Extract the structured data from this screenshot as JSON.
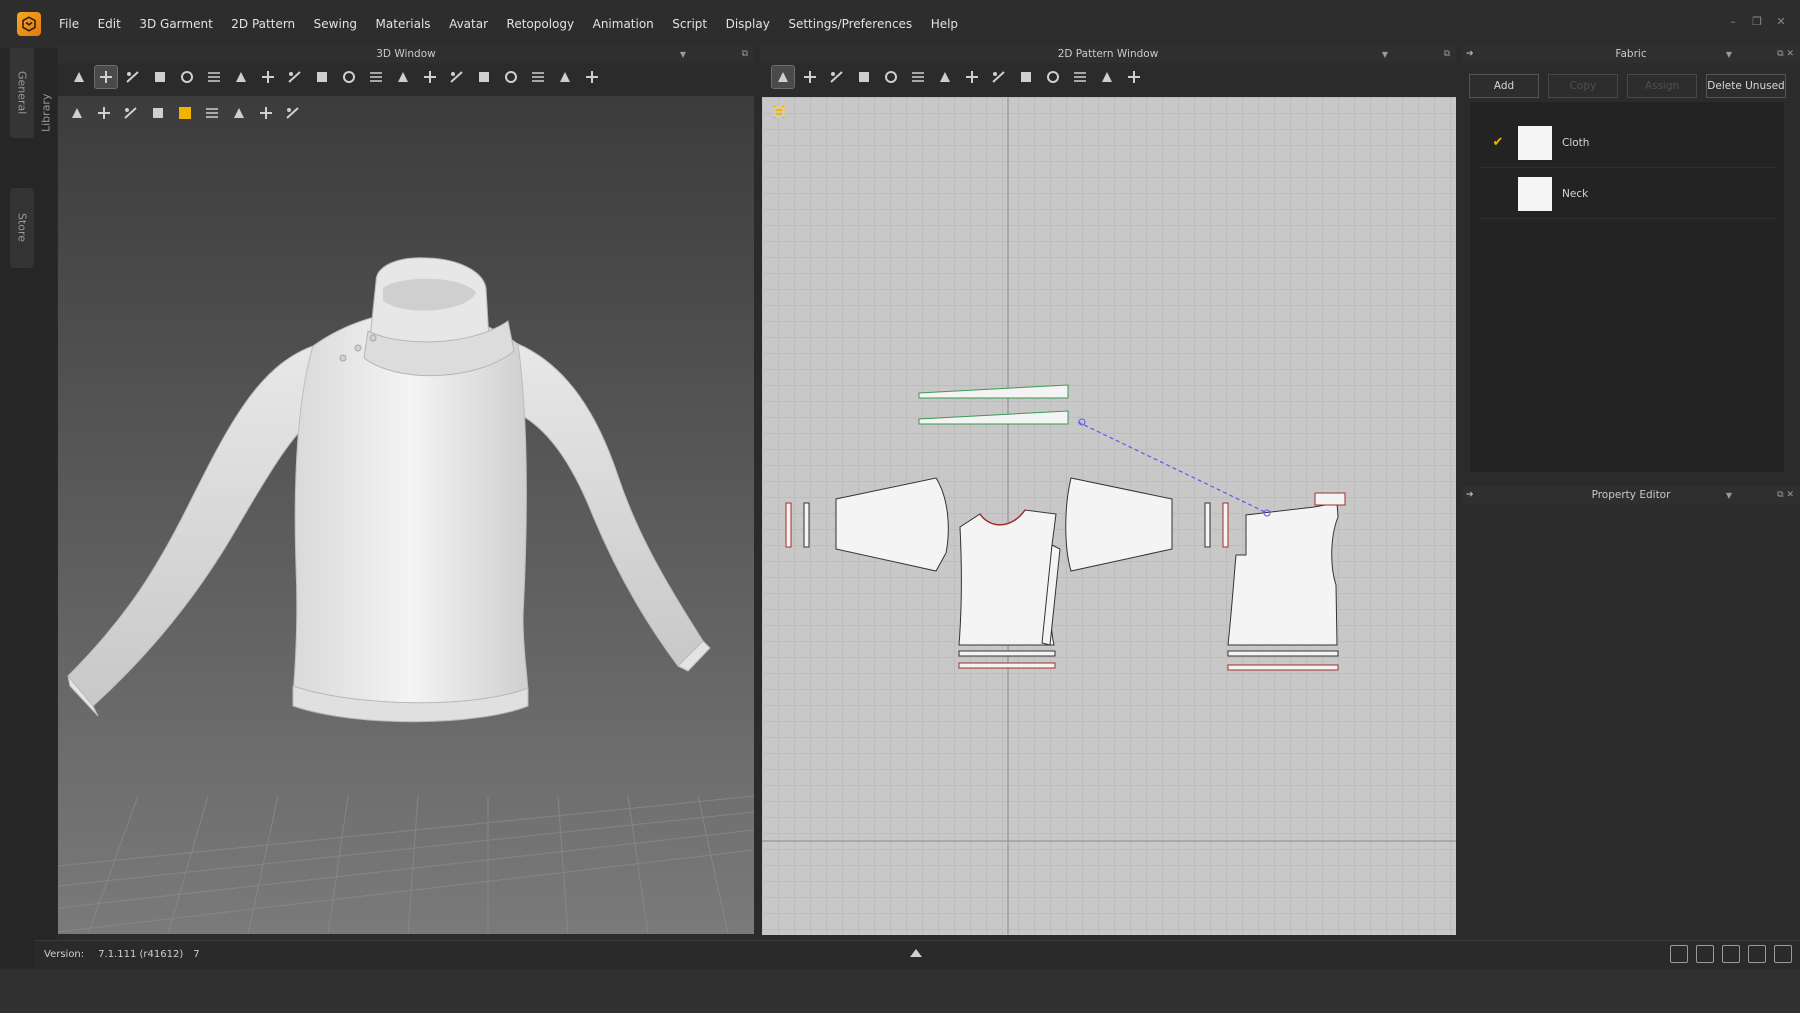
{
  "app": {
    "logo": "marvelous-designer-logo"
  },
  "menu": [
    "File",
    "Edit",
    "3D Garment",
    "2D Pattern",
    "Sewing",
    "Materials",
    "Avatar",
    "Retopology",
    "Animation",
    "Script",
    "Display",
    "Settings/Preferences",
    "Help"
  ],
  "window_controls": {
    "minimize": "–",
    "restore": "❐",
    "close": "✕"
  },
  "side_tabs": {
    "general": "General",
    "library": "Library",
    "store": "Store"
  },
  "window_3d": {
    "title": "3D Window",
    "toolbar_icons": [
      "move-icon",
      "select-move-icon",
      "select-mesh-icon",
      "tack-icon",
      "edit-pin-icon",
      "fold-arrangement-icon",
      "transform-icon",
      "avatar-measure-icon",
      "rotate-icon",
      "steam-icon",
      "brush-icon",
      "fold-icon",
      "punch-icon",
      "puckering-icon",
      "zipper-icon",
      "button-icon",
      "buttonhole-icon",
      "tape-icon",
      "measure-icon",
      "avatar-pose-icon"
    ],
    "toolbar2_icons": [
      "shirt-view-icon",
      "texture-view-icon",
      "sun-icon",
      "avatar-show-icon",
      "color-icon",
      "shadow-icon",
      "skin-icon",
      "sphere-icon",
      "export-icon"
    ]
  },
  "window_2d": {
    "title": "2D Pattern Window",
    "toolbar_icons": [
      "transform-pattern-icon",
      "edit-point-icon",
      "polygon-icon",
      "rectangle-icon",
      "add-point-icon",
      "internal-polygon-icon",
      "dart-icon",
      "trace-icon",
      "segment-sewing-icon",
      "free-sewing-icon",
      "check-sewing-icon",
      "grading-icon",
      "fold-arrangement-icon",
      "shirt-icon"
    ],
    "toolbar2_icons": [
      "brush-icon",
      "pattern-shape-icon",
      "texture-icon",
      "color-icon",
      "sun-icon",
      "export-icon"
    ]
  },
  "fabric_panel": {
    "title": "Fabric",
    "buttons": {
      "add": "Add",
      "copy": "Copy",
      "assign": "Assign",
      "delete_unused": "Delete Unused"
    },
    "items": [
      {
        "name": "Cloth",
        "selected": true,
        "swatch": "#f5f5f5"
      },
      {
        "name": "Neck",
        "selected": false,
        "swatch": "#f5f5f5"
      }
    ]
  },
  "property_editor": {
    "title": "Property Editor"
  },
  "status": {
    "version_label": "Version:",
    "version_value": "7.1.111 (r41612)",
    "extra": "7"
  },
  "colors": {
    "accent": "#f0b400",
    "bg": "#2b2b2b",
    "pattern_outline_red": "#a0302a",
    "pattern_outline_green": "#3a9a50",
    "sewing_line": "#5a5aee"
  }
}
